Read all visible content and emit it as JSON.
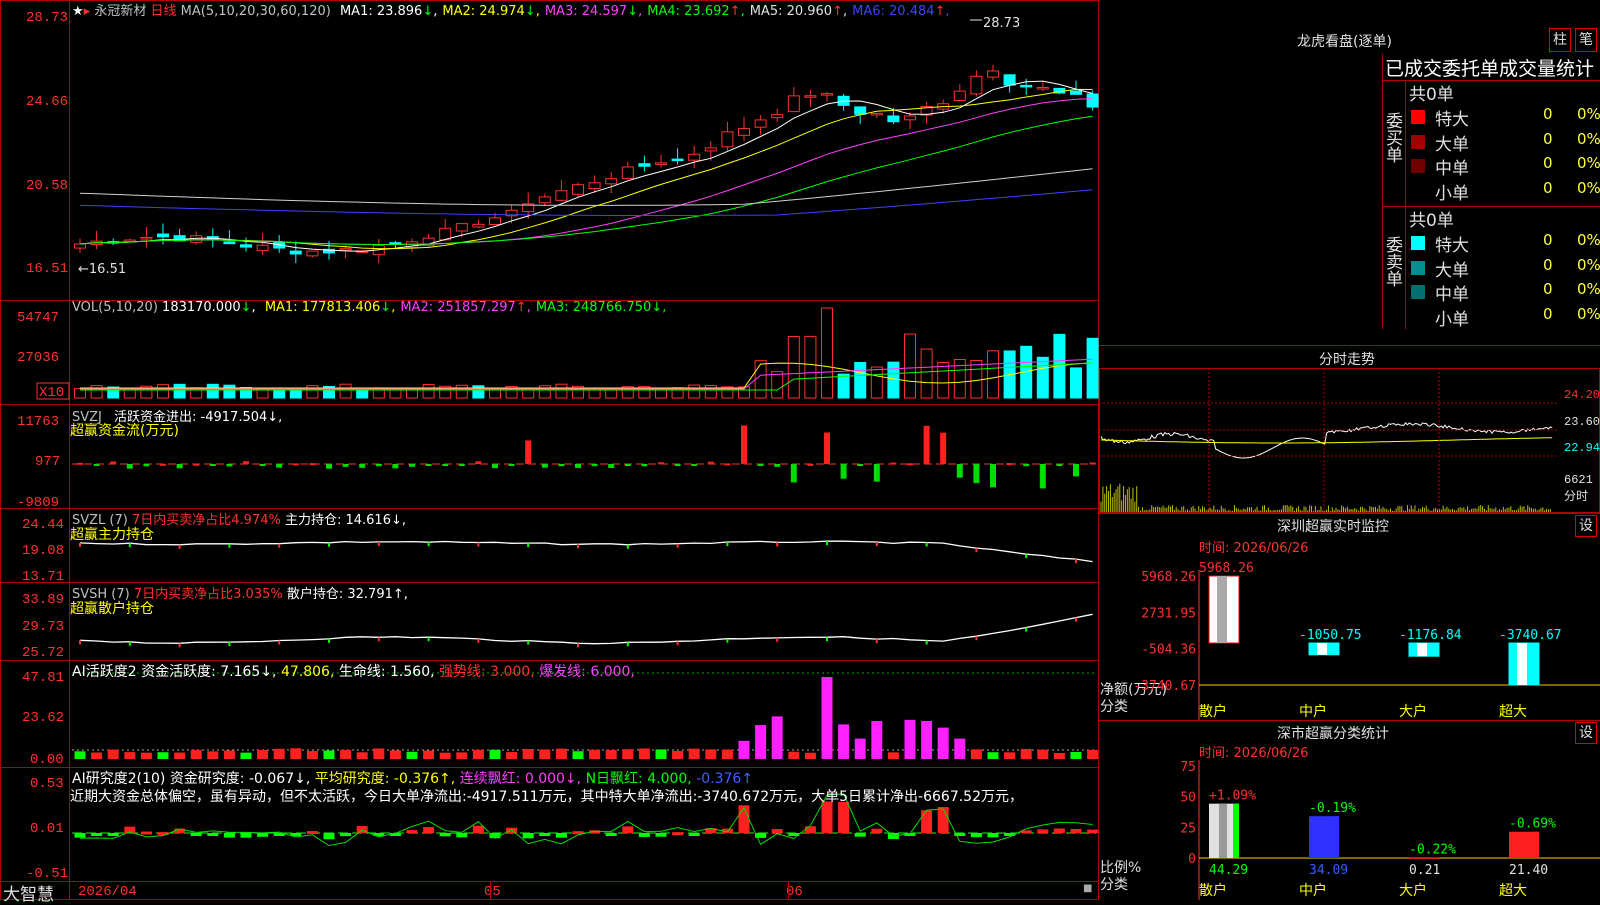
{
  "stock": {
    "name": "永冠新材",
    "period": "日线",
    "ma_header": "MA(5,10,20,30,60,120)",
    "ma": [
      {
        "label": "MA1: 23.896",
        "arrow": "↓",
        "color": "#ffffff"
      },
      {
        "label": "MA2: 24.974",
        "arrow": "↓",
        "color": "#ffff00"
      },
      {
        "label": "MA3: 24.597",
        "arrow": "↓",
        "color": "#ff40ff"
      },
      {
        "label": "MA4: 23.692",
        "arrow": "↑",
        "color": "#00ff00"
      },
      {
        "label": "MA5: 20.960",
        "arrow": "↑",
        "color": "#e0e0e0"
      },
      {
        "label": "MA6: 20.484",
        "arrow": "↑",
        "color": "#4040ff"
      }
    ],
    "y_labels": [
      "28.73",
      "24.66",
      "20.58",
      "16.51"
    ],
    "price_max": "28.73",
    "price_min": "16.51",
    "x_labels": [
      "2026/04",
      "05",
      "06"
    ]
  },
  "panels": {
    "vol": {
      "header": "VOL(5,10,20)",
      "value": "183170.000",
      "items": [
        {
          "label": "MA1: 177813.406",
          "arrow": "↓",
          "color": "#ffff00"
        },
        {
          "label": "MA2: 251857.297",
          "arrow": "↑",
          "color": "#ff40ff"
        },
        {
          "label": "MA3: 248766.750",
          "arrow": "↓",
          "color": "#00ff00"
        }
      ],
      "y_labels": [
        "54747",
        "27036"
      ],
      "unit": "X10"
    },
    "svzj": {
      "header": "SVZJ",
      "text": "活跃资金进出: -4917.504↓,",
      "sub": "超赢资金流(万元)",
      "y_labels": [
        "11763",
        "977",
        "-9809"
      ]
    },
    "svzl": {
      "header": "SVZL (7)",
      "text1": "7日内买卖净占比4.974%",
      "text2": "主力持仓: 14.616↓,",
      "sub": "超赢主力持仓",
      "y_labels": [
        "24.44",
        "19.08",
        "13.71"
      ]
    },
    "svsh": {
      "header": "SVSH (7)",
      "text1": "7日内买卖净占比3.035%",
      "text2": "散户持仓: 32.791↑,",
      "sub": "超赢散户持仓",
      "y_labels": [
        "33.89",
        "29.73",
        "25.72"
      ]
    },
    "ai1": {
      "header": "AI活跃度2",
      "t1": "资金活跃度: 7.165↓,",
      "t2": "47.806,",
      "t3": "生命线: 1.560,",
      "t4": "强势线: 3.000,",
      "t5": "爆发线: 6.000,",
      "y_labels": [
        "47.81",
        "23.62",
        "0.00"
      ]
    },
    "ai2": {
      "header": "AI研究度2(10)",
      "t1": "资金研究度: -0.067↓,",
      "t2": "平均研究度: -0.376↑,",
      "t3": "连续飘红: 0.000↓,",
      "t4": "N日飘红: 4.000,",
      "t5": "-0.376↑",
      "note": "近期大资金总体偏空，虽有异动，但不太活跃，今日大单净流出:-4917.511万元，其中特大单净流出:-3740.672万元，大单5日累计净出-6667.52万元，",
      "y_labels": [
        "0.53",
        "0.01",
        "-0.51"
      ]
    }
  },
  "footer": {
    "brand": "大智慧"
  },
  "lhb": {
    "title": "龙虎看盘(逐单)",
    "tab_zhu": "柱",
    "tab_bi": "笔",
    "subtitle": "已成交委托单成交量统计",
    "buy": {
      "side_label": "委买单",
      "total": "共0单",
      "rows": [
        {
          "label": "特大",
          "v1": "0",
          "v2": "0%",
          "color": "#ff0000"
        },
        {
          "label": "大单",
          "v1": "0",
          "v2": "0%",
          "color": "#a00000"
        },
        {
          "label": "中单",
          "v1": "0",
          "v2": "0%",
          "color": "#700000"
        },
        {
          "label": "小单",
          "v1": "0",
          "v2": "0%",
          "color": "#000000"
        }
      ]
    },
    "sell": {
      "side_label": "委卖单",
      "total": "共0单",
      "rows": [
        {
          "label": "特大",
          "v1": "0",
          "v2": "0%",
          "color": "#00ffff"
        },
        {
          "label": "大单",
          "v1": "0",
          "v2": "0%",
          "color": "#009090"
        },
        {
          "label": "中单",
          "v1": "0",
          "v2": "0%",
          "color": "#007070"
        },
        {
          "label": "小单",
          "v1": "0",
          "v2": "0%",
          "color": "#000000"
        }
      ]
    }
  },
  "intraday": {
    "title": "分时走势",
    "y_labels": [
      "24.20",
      "23.60",
      "22.94",
      "6621"
    ],
    "unit": "分时"
  },
  "monitor": {
    "title": "深圳超赢实时监控",
    "btn": "设",
    "time": "时间: 2026/06/26",
    "y_labels": [
      "5968.26",
      "2731.95",
      "-504.36",
      "-3740.67"
    ],
    "axis_label": "净额(万元)",
    "cat_label": "分类",
    "bars": [
      {
        "cat": "散户",
        "value": 5968.26,
        "label": "5968.26"
      },
      {
        "cat": "中户",
        "value": -1050.75,
        "label": "-1050.75"
      },
      {
        "cat": "大户",
        "value": -1176.84,
        "label": "-1176.84"
      },
      {
        "cat": "超大",
        "value": -3740.67,
        "label": "-3740.67"
      }
    ]
  },
  "classify": {
    "title": "深市超赢分类统计",
    "btn": "设",
    "time": "时间: 2026/06/26",
    "y_labels": [
      "75",
      "50",
      "25",
      "0"
    ],
    "axis_label": "比例%",
    "cat_label": "分类",
    "bars": [
      {
        "cat": "散户",
        "value": 44.29,
        "label": "44.29",
        "change": "+1.09%",
        "color": "#e0e0e0",
        "accent": "#00ff00"
      },
      {
        "cat": "中户",
        "value": 34.09,
        "label": "34.09",
        "change": "-0.19%",
        "color": "#3030ff",
        "accent": "#3030ff"
      },
      {
        "cat": "大户",
        "value": 0.21,
        "label": "0.21",
        "change": "-0.22%",
        "color": "#ff3030",
        "accent": "#ff3030"
      },
      {
        "cat": "超大",
        "value": 21.4,
        "label": "21.40",
        "change": "-0.69%",
        "color": "#ff2020",
        "accent": "#ff2020"
      }
    ]
  }
}
